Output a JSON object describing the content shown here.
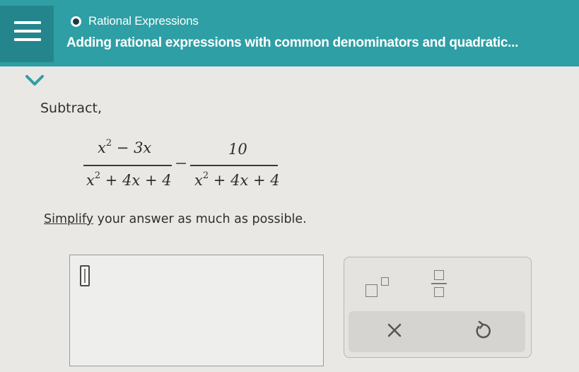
{
  "header": {
    "menu_icon": "hamburger-menu-icon",
    "topic_icon": "radio-icon",
    "topic": "Rational Expressions",
    "lesson": "Adding rational expressions with common denominators and quadratic..."
  },
  "collapse_icon": "chevron-down-icon",
  "problem": {
    "prompt": "Subtract,",
    "expression": {
      "left_num": "x² − 3x",
      "left_den": "x² + 4x + 4",
      "operator": "−",
      "right_num": "10",
      "right_den": "x² + 4x + 4"
    },
    "instruction_link": "Simplify",
    "instruction_rest": " your answer as much as possible."
  },
  "answer": {
    "value": ""
  },
  "toolbox": {
    "exponent_icon": "exponent-icon",
    "fraction_icon": "fraction-icon",
    "clear_label": "×",
    "undo_icon": "undo-icon"
  },
  "colors": {
    "header_bg": "#2d9fa5",
    "menu_bg": "#24868c",
    "page_bg": "#e9e8e4",
    "accent_dark": "#1c3c45",
    "chevron": "#2d9fa5"
  }
}
